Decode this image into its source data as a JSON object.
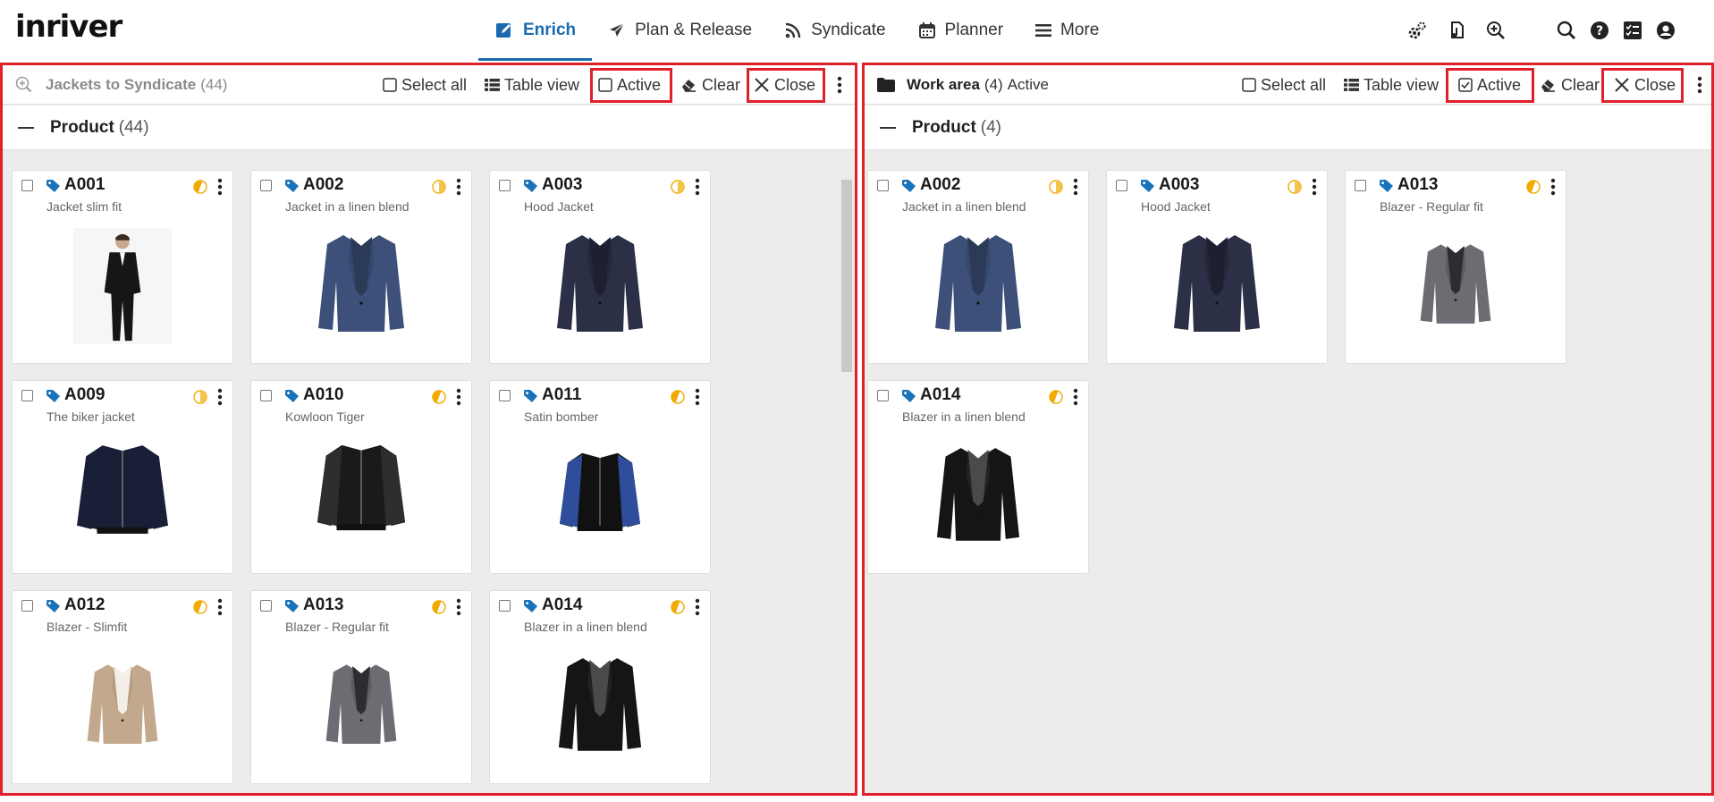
{
  "app": {
    "logo": "inriver"
  },
  "nav": [
    {
      "label": "Enrich",
      "icon": "edit-icon",
      "active": true
    },
    {
      "label": "Plan & Release",
      "icon": "paper-plane-icon",
      "active": false
    },
    {
      "label": "Syndicate",
      "icon": "rss-icon",
      "active": false
    },
    {
      "label": "Planner",
      "icon": "calendar-icon",
      "active": false
    },
    {
      "label": "More",
      "icon": "hamburger-icon",
      "active": false
    }
  ],
  "top_icons": [
    "settings-gears-icon",
    "file-music-icon",
    "zoom-in-icon",
    "search-icon",
    "help-icon",
    "tasks-icon",
    "user-icon"
  ],
  "left_panel": {
    "title": "Jackets to Syndicate",
    "count": "(44)",
    "toolbar": {
      "select_all": "Select all",
      "table_view": "Table view",
      "active": "Active",
      "clear": "Clear",
      "close": "Close"
    },
    "active_checked": false,
    "group": {
      "label": "Product",
      "count": "(44)"
    },
    "cards": [
      {
        "code": "A001",
        "name": "Jacket slim fit",
        "image": "man-in-black-suit",
        "status": "half"
      },
      {
        "code": "A002",
        "name": "Jacket in a linen blend",
        "image": "navy-blazer",
        "status": "half-light"
      },
      {
        "code": "A003",
        "name": "Hood Jacket",
        "image": "dark-navy-blazer",
        "status": "half-light"
      },
      {
        "code": "A009",
        "name": "The biker jacket",
        "image": "navy-bomber",
        "status": "half-light"
      },
      {
        "code": "A010",
        "name": "Kowloon Tiger",
        "image": "black-varsity-jacket",
        "status": "half"
      },
      {
        "code": "A011",
        "name": "Satin bomber",
        "image": "satin-bomber",
        "status": "half"
      },
      {
        "code": "A012",
        "name": "Blazer - Slimfit",
        "image": "beige-blazer",
        "status": "half"
      },
      {
        "code": "A013",
        "name": "Blazer - Regular fit",
        "image": "grey-blazer",
        "status": "half"
      },
      {
        "code": "A014",
        "name": "Blazer in a linen blend",
        "image": "black-blazer",
        "status": "half"
      }
    ]
  },
  "right_panel": {
    "title": "Work area",
    "count": "(4)",
    "state": "Active",
    "toolbar": {
      "select_all": "Select all",
      "table_view": "Table view",
      "active": "Active",
      "clear": "Clear",
      "close": "Close"
    },
    "active_checked": true,
    "group": {
      "label": "Product",
      "count": "(4)"
    },
    "cards": [
      {
        "code": "A002",
        "name": "Jacket in a linen blend",
        "image": "navy-blazer",
        "status": "half-light"
      },
      {
        "code": "A003",
        "name": "Hood Jacket",
        "image": "dark-navy-blazer",
        "status": "half-light"
      },
      {
        "code": "A013",
        "name": "Blazer - Regular fit",
        "image": "grey-blazer",
        "status": "half"
      },
      {
        "code": "A014",
        "name": "Blazer in a linen blend",
        "image": "black-blazer",
        "status": "half"
      }
    ]
  },
  "colors": {
    "accent": "#1a6ab2",
    "highlight": "#e0202a",
    "status": "#f2a900",
    "tag": "#1a73b8"
  }
}
